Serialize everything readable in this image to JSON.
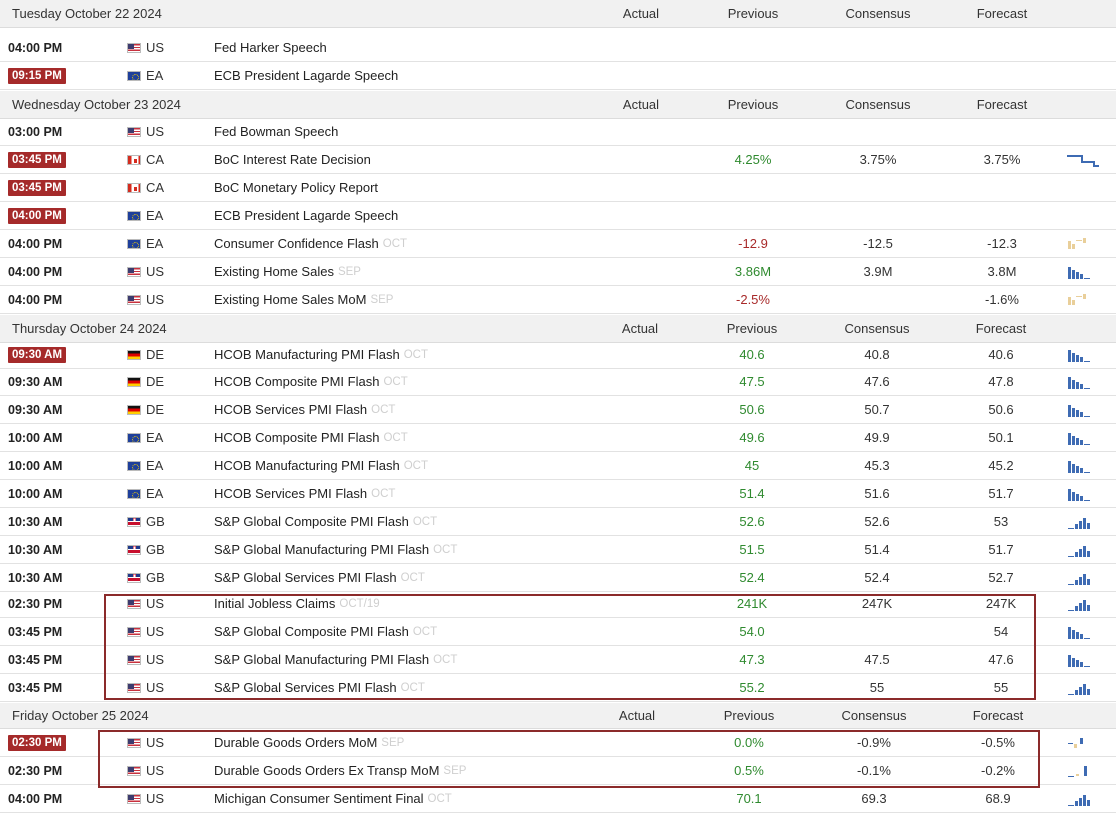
{
  "columns": {
    "actual": "Actual",
    "previous": "Previous",
    "consensus": "Consensus",
    "forecast": "Forecast"
  },
  "colors": {
    "badge": "#a52a2a",
    "positive": "#2f8a2f",
    "negative": "#a82a2a",
    "spark_blue": "#3e6bb3",
    "spark_tan": "#e9cf9a",
    "highlight": "#8b2a2a"
  },
  "days": [
    {
      "label": "Tuesday October 22 2024",
      "events": [
        {
          "time": "04:00 PM",
          "badge": false,
          "country": "US",
          "event": "Fed Harker Speech",
          "ref": "",
          "actual": "",
          "previous": "",
          "consensus": "",
          "forecast": "",
          "spark": ""
        },
        {
          "time": "09:15 PM",
          "badge": true,
          "country": "EA",
          "event": "ECB President Lagarde Speech",
          "ref": "",
          "actual": "",
          "previous": "",
          "consensus": "",
          "forecast": "",
          "spark": ""
        }
      ]
    },
    {
      "label": "Wednesday October 23 2024",
      "events": [
        {
          "time": "03:00 PM",
          "badge": false,
          "country": "US",
          "event": "Fed Bowman Speech",
          "ref": "",
          "actual": "",
          "previous": "",
          "consensus": "",
          "forecast": "",
          "spark": ""
        },
        {
          "time": "03:45 PM",
          "badge": true,
          "country": "CA",
          "event": "BoC Interest Rate Decision",
          "ref": "",
          "actual": "",
          "previous": "4.25%",
          "previous_tone": "up",
          "consensus": "3.75%",
          "forecast": "3.75%",
          "spark": "step"
        },
        {
          "time": "03:45 PM",
          "badge": true,
          "country": "CA",
          "event": "BoC Monetary Policy Report",
          "ref": "",
          "actual": "",
          "previous": "",
          "consensus": "",
          "forecast": "",
          "spark": ""
        },
        {
          "time": "04:00 PM",
          "badge": true,
          "country": "EA",
          "event": "ECB President Lagarde Speech",
          "ref": "",
          "actual": "",
          "previous": "",
          "consensus": "",
          "forecast": "",
          "spark": ""
        },
        {
          "time": "04:00 PM",
          "badge": false,
          "country": "EA",
          "event": "Consumer Confidence Flash",
          "ref": "OCT",
          "actual": "",
          "previous": "-12.9",
          "previous_tone": "down",
          "consensus": "-12.5",
          "forecast": "-12.3",
          "spark": "tan"
        },
        {
          "time": "04:00 PM",
          "badge": false,
          "country": "US",
          "event": "Existing Home Sales",
          "ref": "SEP",
          "actual": "",
          "previous": "3.86M",
          "previous_tone": "up",
          "consensus": "3.9M",
          "forecast": "3.8M",
          "spark": "bars"
        },
        {
          "time": "04:00 PM",
          "badge": false,
          "country": "US",
          "event": "Existing Home Sales MoM",
          "ref": "SEP",
          "actual": "",
          "previous": "-2.5%",
          "previous_tone": "down",
          "consensus": "",
          "forecast": "-1.6%",
          "spark": "tan"
        }
      ]
    },
    {
      "label": "Thursday October 24 2024",
      "events": [
        {
          "time": "09:30 AM",
          "badge": true,
          "country": "DE",
          "event": "HCOB Manufacturing PMI Flash",
          "ref": "OCT",
          "actual": "",
          "previous": "40.6",
          "previous_tone": "up",
          "consensus": "40.8",
          "forecast": "40.6",
          "spark": "bars"
        },
        {
          "time": "09:30 AM",
          "badge": false,
          "country": "DE",
          "event": "HCOB Composite PMI Flash",
          "ref": "OCT",
          "actual": "",
          "previous": "47.5",
          "previous_tone": "up",
          "consensus": "47.6",
          "forecast": "47.8",
          "spark": "bars"
        },
        {
          "time": "09:30 AM",
          "badge": false,
          "country": "DE",
          "event": "HCOB Services PMI Flash",
          "ref": "OCT",
          "actual": "",
          "previous": "50.6",
          "previous_tone": "up",
          "consensus": "50.7",
          "forecast": "50.6",
          "spark": "bars"
        },
        {
          "time": "10:00 AM",
          "badge": false,
          "country": "EA",
          "event": "HCOB Composite PMI Flash",
          "ref": "OCT",
          "actual": "",
          "previous": "49.6",
          "previous_tone": "up",
          "consensus": "49.9",
          "forecast": "50.1",
          "spark": "bars"
        },
        {
          "time": "10:00 AM",
          "badge": false,
          "country": "EA",
          "event": "HCOB Manufacturing PMI Flash",
          "ref": "OCT",
          "actual": "",
          "previous": "45",
          "previous_tone": "up",
          "consensus": "45.3",
          "forecast": "45.2",
          "spark": "bars"
        },
        {
          "time": "10:00 AM",
          "badge": false,
          "country": "EA",
          "event": "HCOB Services PMI Flash",
          "ref": "OCT",
          "actual": "",
          "previous": "51.4",
          "previous_tone": "up",
          "consensus": "51.6",
          "forecast": "51.7",
          "spark": "bars"
        },
        {
          "time": "10:30 AM",
          "badge": false,
          "country": "GB",
          "event": "S&P Global Composite PMI Flash",
          "ref": "OCT",
          "actual": "",
          "previous": "52.6",
          "previous_tone": "up",
          "consensus": "52.6",
          "forecast": "53",
          "spark": "rise"
        },
        {
          "time": "10:30 AM",
          "badge": false,
          "country": "GB",
          "event": "S&P Global Manufacturing PMI Flash",
          "ref": "OCT",
          "actual": "",
          "previous": "51.5",
          "previous_tone": "up",
          "consensus": "51.4",
          "forecast": "51.7",
          "spark": "rise"
        },
        {
          "time": "10:30 AM",
          "badge": false,
          "country": "GB",
          "event": "S&P Global Services PMI Flash",
          "ref": "OCT",
          "actual": "",
          "previous": "52.4",
          "previous_tone": "up",
          "consensus": "52.4",
          "forecast": "52.7",
          "spark": "rise"
        },
        {
          "time": "02:30 PM",
          "badge": false,
          "country": "US",
          "event": "Initial Jobless Claims",
          "ref": "OCT/19",
          "actual": "",
          "previous": "241K",
          "previous_tone": "up",
          "consensus": "247K",
          "forecast": "247K",
          "spark": "rise"
        },
        {
          "time": "03:45 PM",
          "badge": false,
          "country": "US",
          "event": "S&P Global Composite PMI Flash",
          "ref": "OCT",
          "actual": "",
          "previous": "54.0",
          "previous_tone": "up",
          "consensus": "",
          "forecast": "54",
          "spark": "bars"
        },
        {
          "time": "03:45 PM",
          "badge": false,
          "country": "US",
          "event": "S&P Global Manufacturing PMI Flash",
          "ref": "OCT",
          "actual": "",
          "previous": "47.3",
          "previous_tone": "up",
          "consensus": "47.5",
          "forecast": "47.6",
          "spark": "bars"
        },
        {
          "time": "03:45 PM",
          "badge": false,
          "country": "US",
          "event": "S&P Global Services PMI Flash",
          "ref": "OCT",
          "actual": "",
          "previous": "55.2",
          "previous_tone": "up",
          "consensus": "55",
          "forecast": "55",
          "spark": "rise"
        }
      ]
    },
    {
      "label": "Friday October 25 2024",
      "events": [
        {
          "time": "02:30 PM",
          "badge": true,
          "country": "US",
          "event": "Durable Goods Orders MoM",
          "ref": "SEP",
          "actual": "",
          "previous": "0.0%",
          "previous_tone": "up",
          "consensus": "-0.9%",
          "forecast": "-0.5%",
          "spark": "mixed"
        },
        {
          "time": "02:30 PM",
          "badge": false,
          "country": "US",
          "event": "Durable Goods Orders Ex Transp MoM",
          "ref": "SEP",
          "actual": "",
          "previous": "0.5%",
          "previous_tone": "up",
          "consensus": "-0.1%",
          "forecast": "-0.2%",
          "spark": "mixed2"
        },
        {
          "time": "04:00 PM",
          "badge": false,
          "country": "US",
          "event": "Michigan Consumer Sentiment Final",
          "ref": "OCT",
          "actual": "",
          "previous": "70.1",
          "previous_tone": "up",
          "consensus": "69.3",
          "forecast": "68.9",
          "spark": "rise"
        }
      ]
    }
  ]
}
